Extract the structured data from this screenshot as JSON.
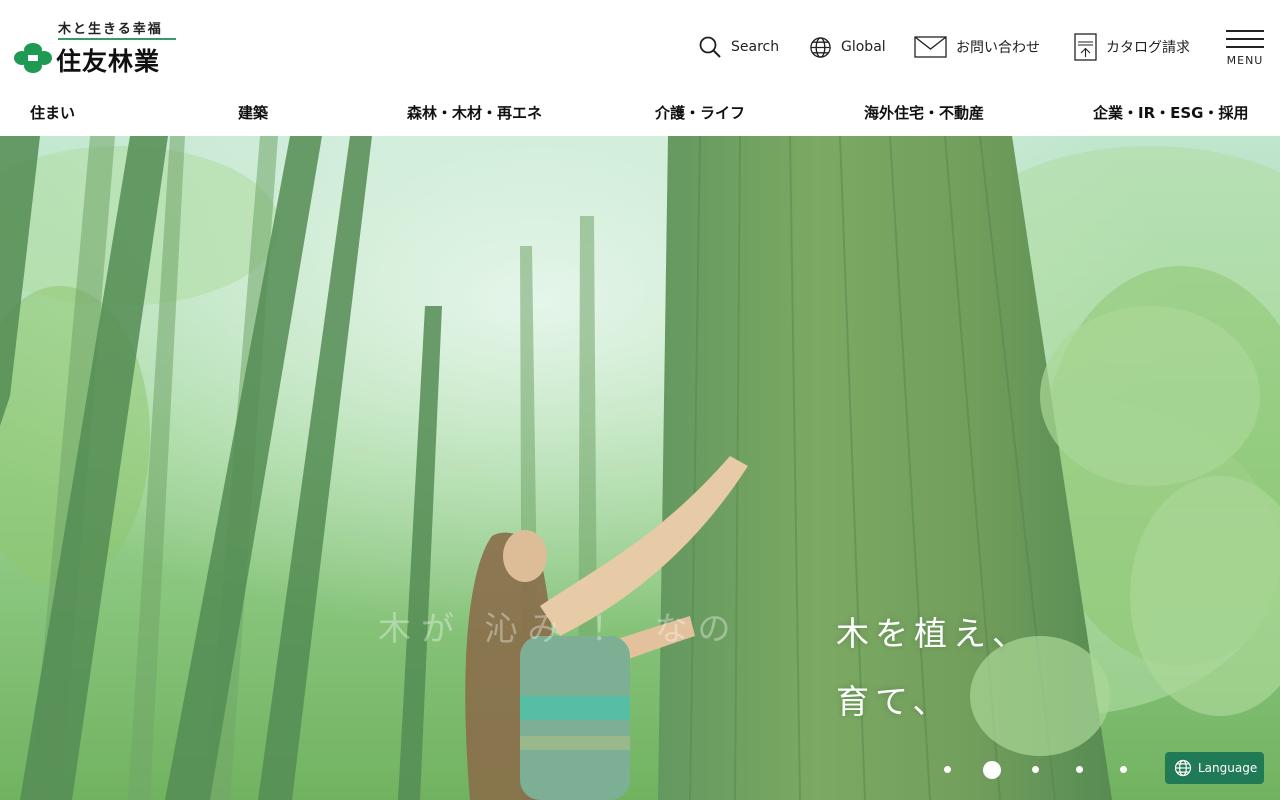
{
  "logo": {
    "tagline": "木と生きる幸福",
    "name": "住友林業"
  },
  "header": {
    "search_label": "Search",
    "global_label": "Global",
    "contact_label": "お問い合わせ",
    "catalog_label": "カタログ請求",
    "menu_label": "MENU"
  },
  "nav": {
    "items": [
      {
        "label": "住まい"
      },
      {
        "label": "建築"
      },
      {
        "label": "森林・木材・再エネ"
      },
      {
        "label": "介護・ライフ"
      },
      {
        "label": "海外住宅・不動産"
      },
      {
        "label": "企業・IR・ESG・採用"
      }
    ]
  },
  "hero": {
    "copy_line1": "木を植え、",
    "copy_line2": "育て、",
    "ghost_copy": "木が 沁み ！ なの",
    "slides_total": 5,
    "active_slide": 2
  },
  "language_button": {
    "label": "Language"
  },
  "colors": {
    "brand_green": "#1f7a55",
    "logo_green": "#1e9a55",
    "rule_green": "#3a9b62"
  },
  "icons": [
    "search-icon",
    "globe-icon",
    "mail-icon",
    "catalog-icon",
    "hamburger-icon",
    "globe-icon"
  ]
}
